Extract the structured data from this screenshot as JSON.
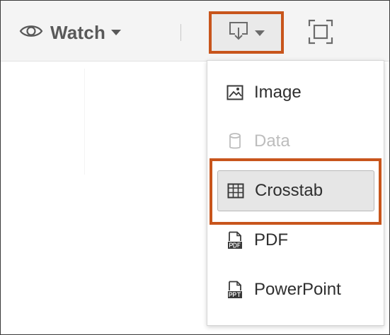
{
  "toolbar": {
    "watch_label": "Watch",
    "icons": {
      "watch": "eye-icon",
      "download": "download-icon",
      "fullscreen": "fullscreen-icon",
      "caret": "caret-down-icon"
    }
  },
  "download_menu": {
    "items": [
      {
        "label": "Image",
        "icon": "image-icon",
        "enabled": true
      },
      {
        "label": "Data",
        "icon": "database-icon",
        "enabled": false
      },
      {
        "label": "Crosstab",
        "icon": "crosstab-icon",
        "enabled": true,
        "highlighted": true
      },
      {
        "label": "PDF",
        "icon": "pdf-icon",
        "enabled": true
      },
      {
        "label": "PowerPoint",
        "icon": "powerpoint-icon",
        "enabled": true
      }
    ]
  },
  "colors": {
    "highlight_outline": "#c8551c",
    "toolbar_background": "#f4f4f4",
    "disabled_text": "#bdbdbd"
  }
}
